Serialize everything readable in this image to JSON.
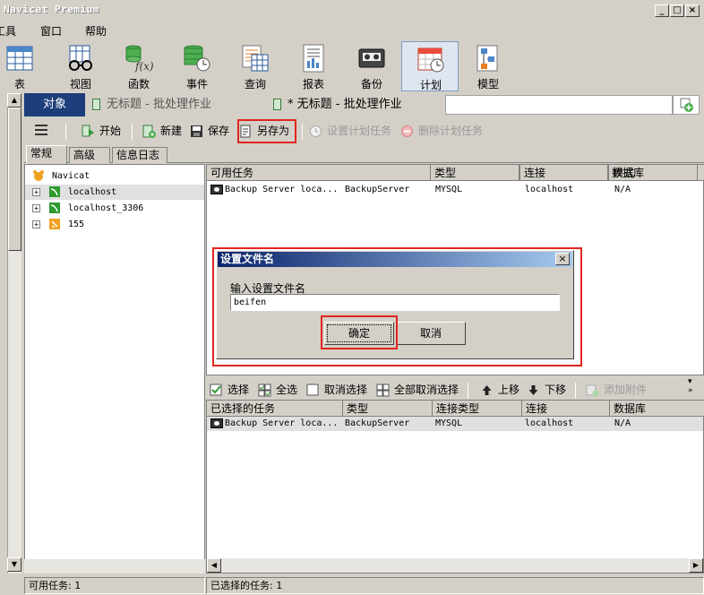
{
  "window": {
    "title": "Navicat Premium",
    "min": "_",
    "max": "□",
    "close": "×"
  },
  "menu": [
    "工具",
    "窗口",
    "帮助"
  ],
  "toolbar": [
    {
      "label": "表",
      "icon": "table-icon"
    },
    {
      "label": "视图",
      "icon": "view-glasses-icon"
    },
    {
      "label": "函数",
      "icon": "function-icon"
    },
    {
      "label": "事件",
      "icon": "event-clock-icon"
    },
    {
      "label": "查询",
      "icon": "query-icon"
    },
    {
      "label": "报表",
      "icon": "report-icon"
    },
    {
      "label": "备份",
      "icon": "backup-tape-icon"
    },
    {
      "label": "计划",
      "icon": "schedule-calendar-icon"
    },
    {
      "label": "模型",
      "icon": "model-diagram-icon"
    }
  ],
  "tabs": {
    "objects": "对象",
    "doc1": "无标题 - 批处理作业",
    "doc2": "* 无标题 - 批处理作业"
  },
  "actions": {
    "start": "开始",
    "new": "新建",
    "save": "保存",
    "save_as": "另存为",
    "set_schedule": "设置计划任务",
    "delete_schedule": "删除计划任务"
  },
  "subtabs": [
    "常规",
    "高级",
    "信息日志"
  ],
  "tree": [
    {
      "label": "Navicat",
      "icon": "navicat-icon"
    },
    {
      "label": "localhost",
      "icon": "mysql-connection-icon"
    },
    {
      "label": "localhost_3306",
      "icon": "mysql-connection-icon"
    },
    {
      "label": "155",
      "icon": "connection-icon"
    }
  ],
  "available": {
    "headers": [
      "可用任务",
      "类型",
      "连接",
      "数据库",
      "模式"
    ],
    "rows": [
      [
        "Backup Server loca...",
        "BackupServer",
        "MYSQL",
        "localhost",
        "N/A"
      ]
    ]
  },
  "select_actions": {
    "select": "选择",
    "select_all": "全选",
    "deselect": "取消选择",
    "deselect_all": "全部取消选择",
    "move_up": "上移",
    "move_down": "下移",
    "add_attachment": "添加附件"
  },
  "selected": {
    "headers": [
      "已选择的任务",
      "类型",
      "连接类型",
      "连接",
      "数据库"
    ],
    "rows": [
      [
        "Backup Server loca...",
        "BackupServer",
        "MYSQL",
        "localhost",
        "N/A"
      ]
    ]
  },
  "status": {
    "available": "可用任务: 1",
    "selected": "已选择的任务: 1"
  },
  "dialog": {
    "title": "设置文件名",
    "label": "输入设置文件名",
    "value": "beifen",
    "ok": "确定",
    "cancel": "取消"
  },
  "colors": {
    "accent_red": "#e0251f",
    "tab_blue": "#1c3e7a"
  }
}
